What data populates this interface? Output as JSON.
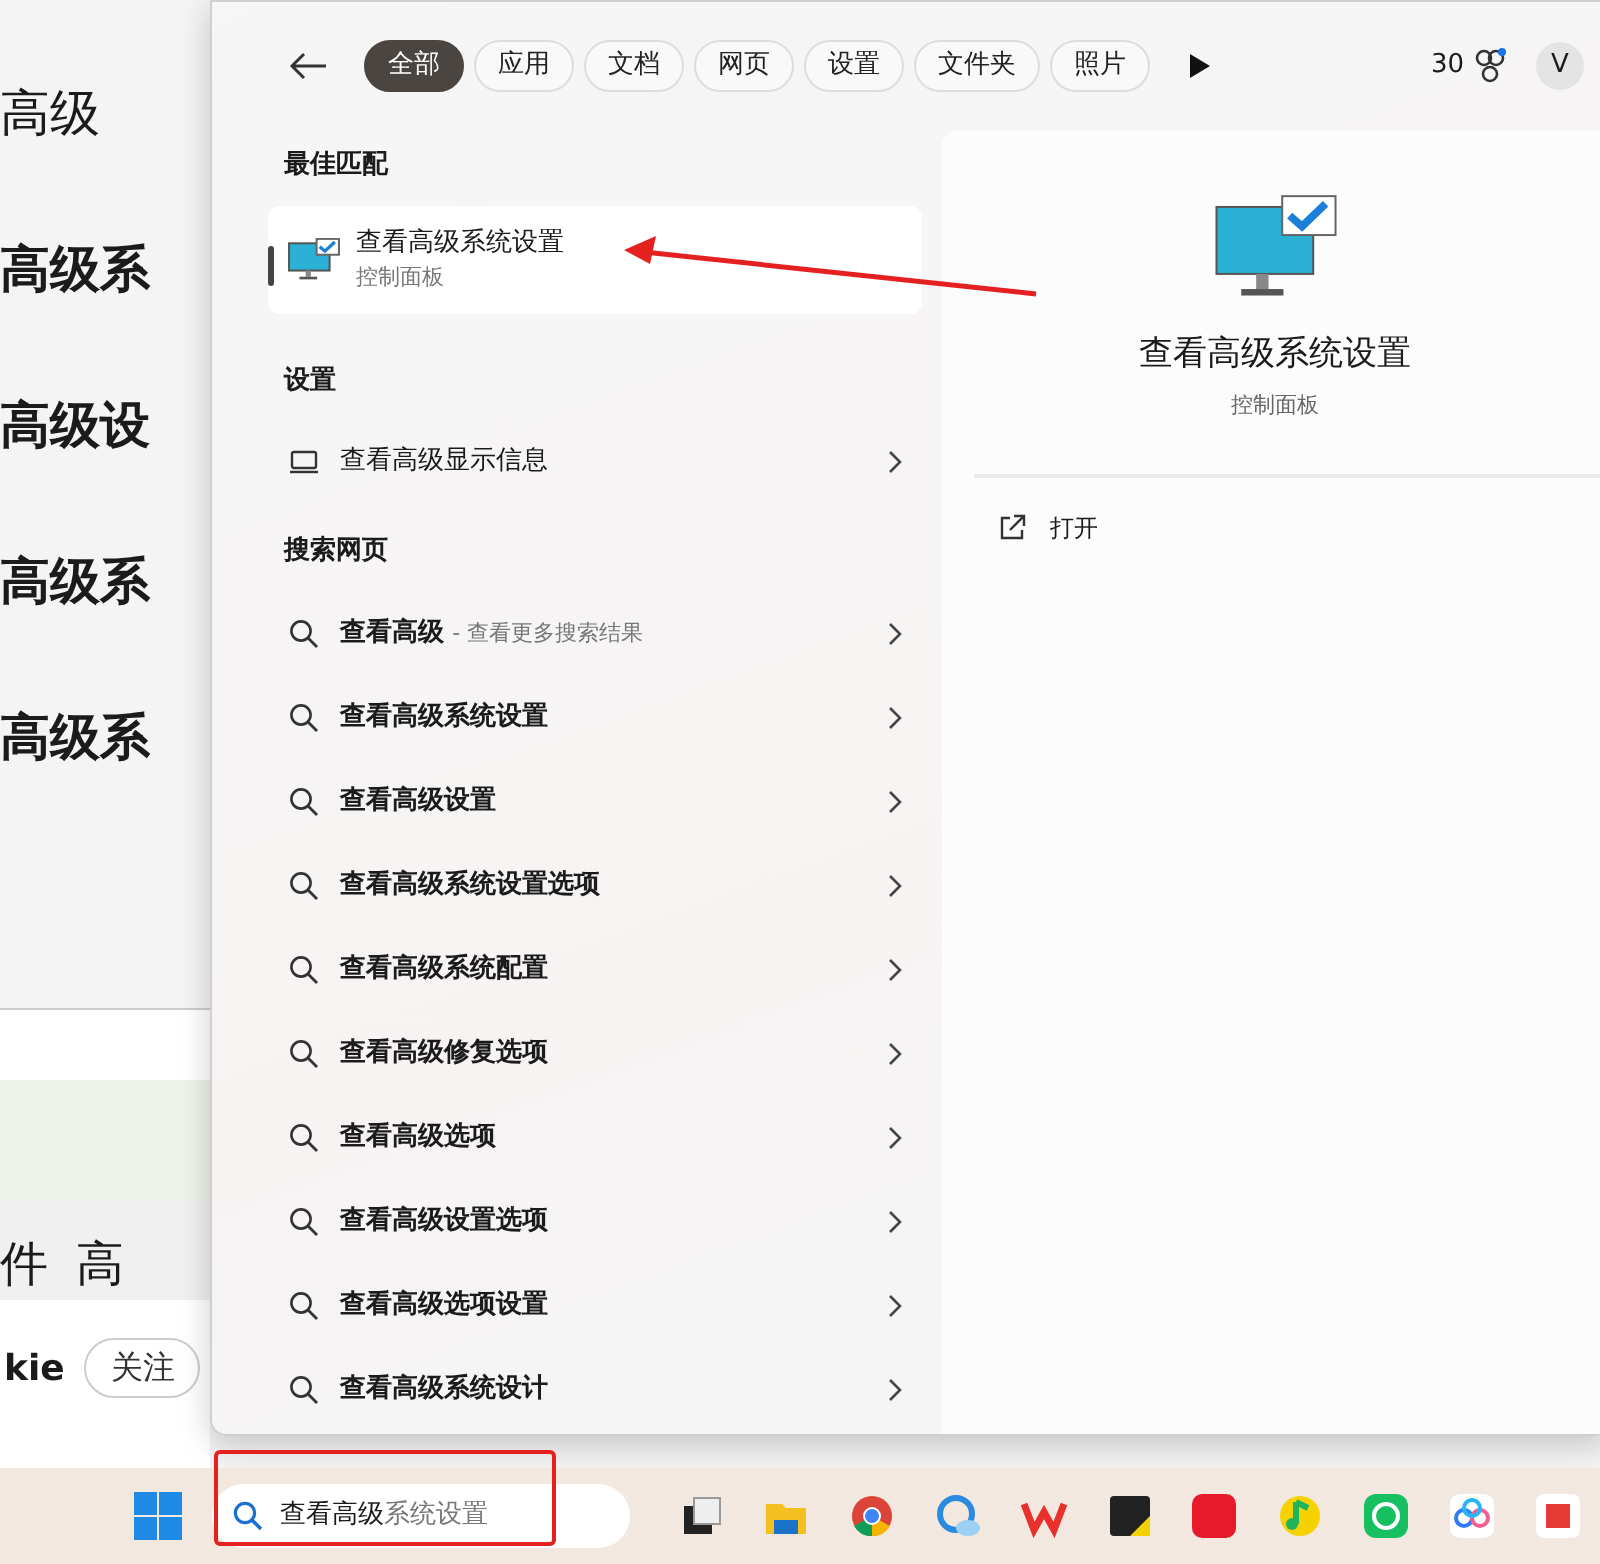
{
  "background_page": {
    "headings": [
      "高级",
      "高级系",
      "高级设",
      "高级系",
      "高级系"
    ],
    "tab_fragments": [
      "件",
      "高"
    ],
    "user": {
      "name_fragment": "kie",
      "follow_button": "关注"
    }
  },
  "search_panel": {
    "filters": [
      {
        "label": "全部",
        "selected": true
      },
      {
        "label": "应用",
        "selected": false
      },
      {
        "label": "文档",
        "selected": false
      },
      {
        "label": "网页",
        "selected": false
      },
      {
        "label": "设置",
        "selected": false
      },
      {
        "label": "文件夹",
        "selected": false
      },
      {
        "label": "照片",
        "selected": false
      }
    ],
    "points": "30",
    "avatar_initial": "V",
    "best_match": {
      "header": "最佳匹配",
      "title": "查看高级系统设置",
      "subtitle": "控制面板",
      "selected": true
    },
    "settings": {
      "header": "设置",
      "items": [
        {
          "label": "查看高级显示信息"
        }
      ]
    },
    "web": {
      "header": "搜索网页",
      "items": [
        {
          "label": "查看高级",
          "hint": "- 查看更多搜索结果"
        },
        {
          "label": "查看高级系统设置"
        },
        {
          "label": "查看高级设置"
        },
        {
          "label": "查看高级系统设置选项"
        },
        {
          "label": "查看高级系统配置"
        },
        {
          "label": "查看高级修复选项"
        },
        {
          "label": "查看高级选项"
        },
        {
          "label": "查看高级设置选项"
        },
        {
          "label": "查看高级选项设置"
        },
        {
          "label": "查看高级系统设计"
        }
      ]
    },
    "preview": {
      "title": "查看高级系统设置",
      "subtitle": "控制面板",
      "actions": [
        {
          "label": "打开"
        }
      ]
    }
  },
  "taskbar": {
    "search": {
      "typed": "查看高级",
      "suggestion": "系统设置"
    }
  }
}
